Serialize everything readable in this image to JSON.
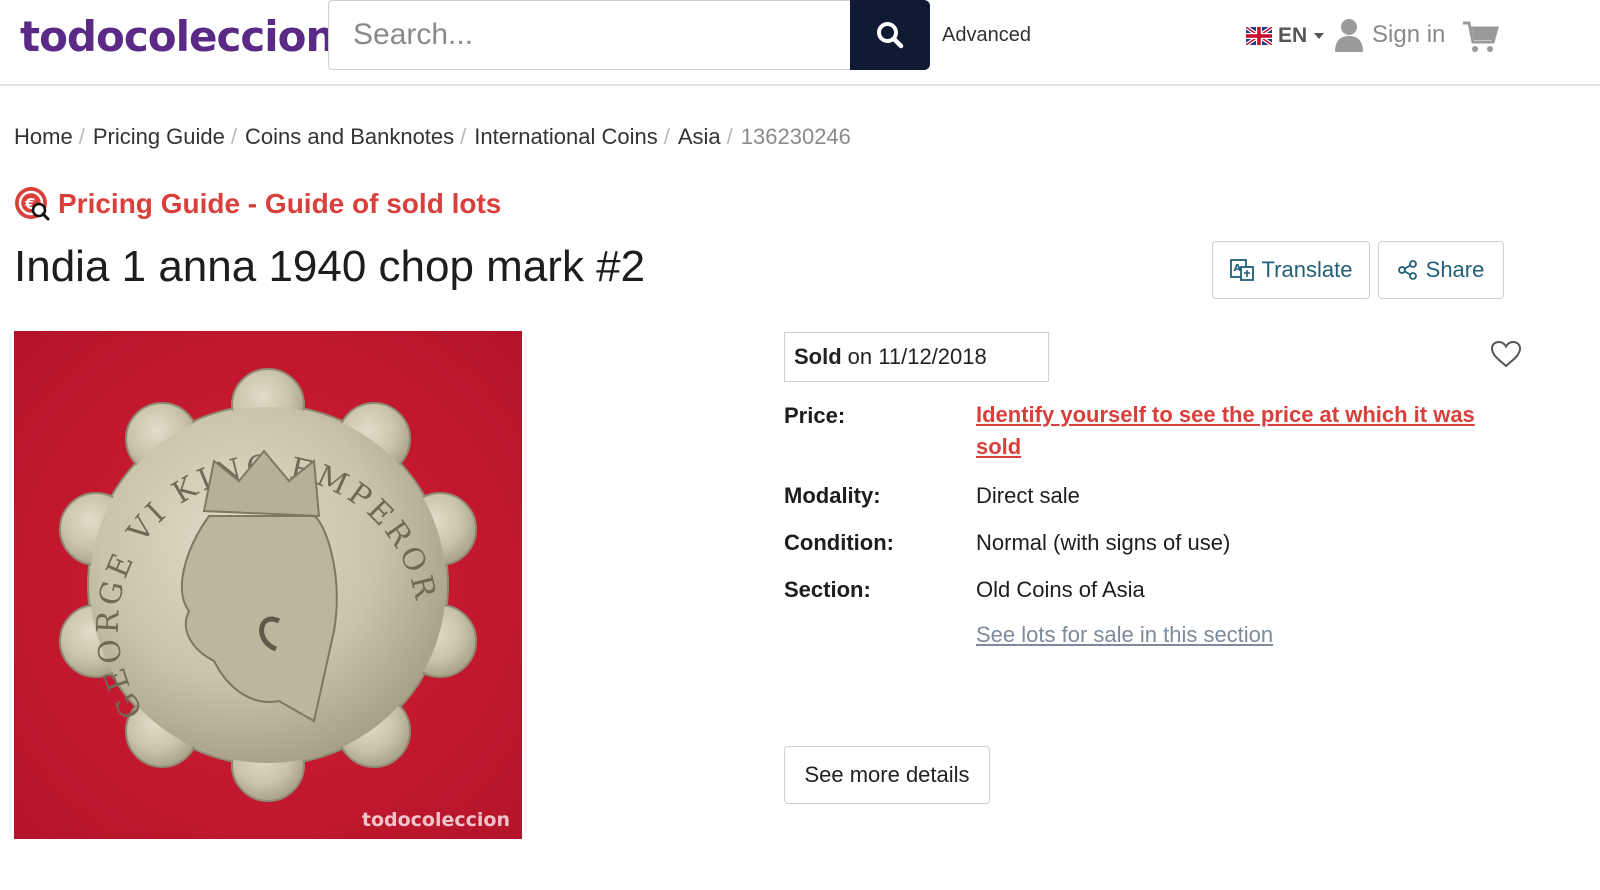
{
  "header": {
    "logo": "todocoleccion",
    "search_placeholder": "Search...",
    "search_icon": "search-icon",
    "advanced_label": "Advanced",
    "language_code": "EN",
    "language_flag": "uk-flag-icon",
    "signin_label": "Sign in",
    "cart_icon": "cart-icon"
  },
  "breadcrumb": {
    "items": [
      "Home",
      "Pricing Guide",
      "Coins and Banknotes",
      "International Coins",
      "Asia"
    ],
    "current": "136230246"
  },
  "guide": {
    "icon": "pricing-guide-icon",
    "label": "Pricing Guide - Guide of sold lots"
  },
  "product": {
    "title": "India 1 anna 1940 chop mark #2",
    "image_watermark": "todocoleccion",
    "translate_label": "Translate",
    "share_label": "Share",
    "sold_strong": "Sold",
    "sold_date": "on 11/12/2018",
    "price_label": "Price:",
    "price_link": "Identify yourself to see the price at which it was sold",
    "modality_label": "Modality:",
    "modality_value": "Direct sale",
    "condition_label": "Condition:",
    "condition_value": "Normal (with signs of use)",
    "section_label": "Section:",
    "section_value": "Old Coins of Asia",
    "section_link": "See lots for sale in this section",
    "more_details_label": "See more details"
  },
  "colors": {
    "brand": "#5b2a86",
    "accent_red": "#d9403b",
    "search_button": "#101a33",
    "link_teal": "#1f5f7a"
  }
}
